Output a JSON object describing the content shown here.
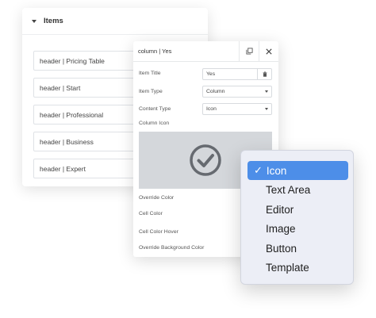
{
  "items_panel": {
    "title": "Items",
    "rows": [
      {
        "label": "header | Pricing Table"
      },
      {
        "label": "header | Start"
      },
      {
        "label": "header | Professional"
      },
      {
        "label": "header | Business"
      },
      {
        "label": "header | Expert"
      }
    ]
  },
  "column_panel": {
    "title": "column | Yes",
    "fields": {
      "item_title_label": "Item Title",
      "item_title_value": "Yes",
      "item_type_label": "Item Type",
      "item_type_value": "Column",
      "content_type_label": "Content Type",
      "content_type_value": "Icon",
      "column_icon_label": "Column Icon",
      "override_color_label": "Override Color",
      "cell_color_label": "Cell Color",
      "cell_color_hover_label": "Cell Color Hover",
      "override_bg_label": "Override Background Color"
    }
  },
  "dropdown": {
    "selected_mark": "✓",
    "options": [
      {
        "label": "Icon",
        "selected": true
      },
      {
        "label": "Text Area",
        "selected": false
      },
      {
        "label": "Editor",
        "selected": false
      },
      {
        "label": "Image",
        "selected": false
      },
      {
        "label": "Button",
        "selected": false
      },
      {
        "label": "Template",
        "selected": false
      }
    ]
  },
  "colors": {
    "accent": "#4d8ee8",
    "preview_bg": "#d4d7db",
    "menu_bg": "#eceef6"
  }
}
